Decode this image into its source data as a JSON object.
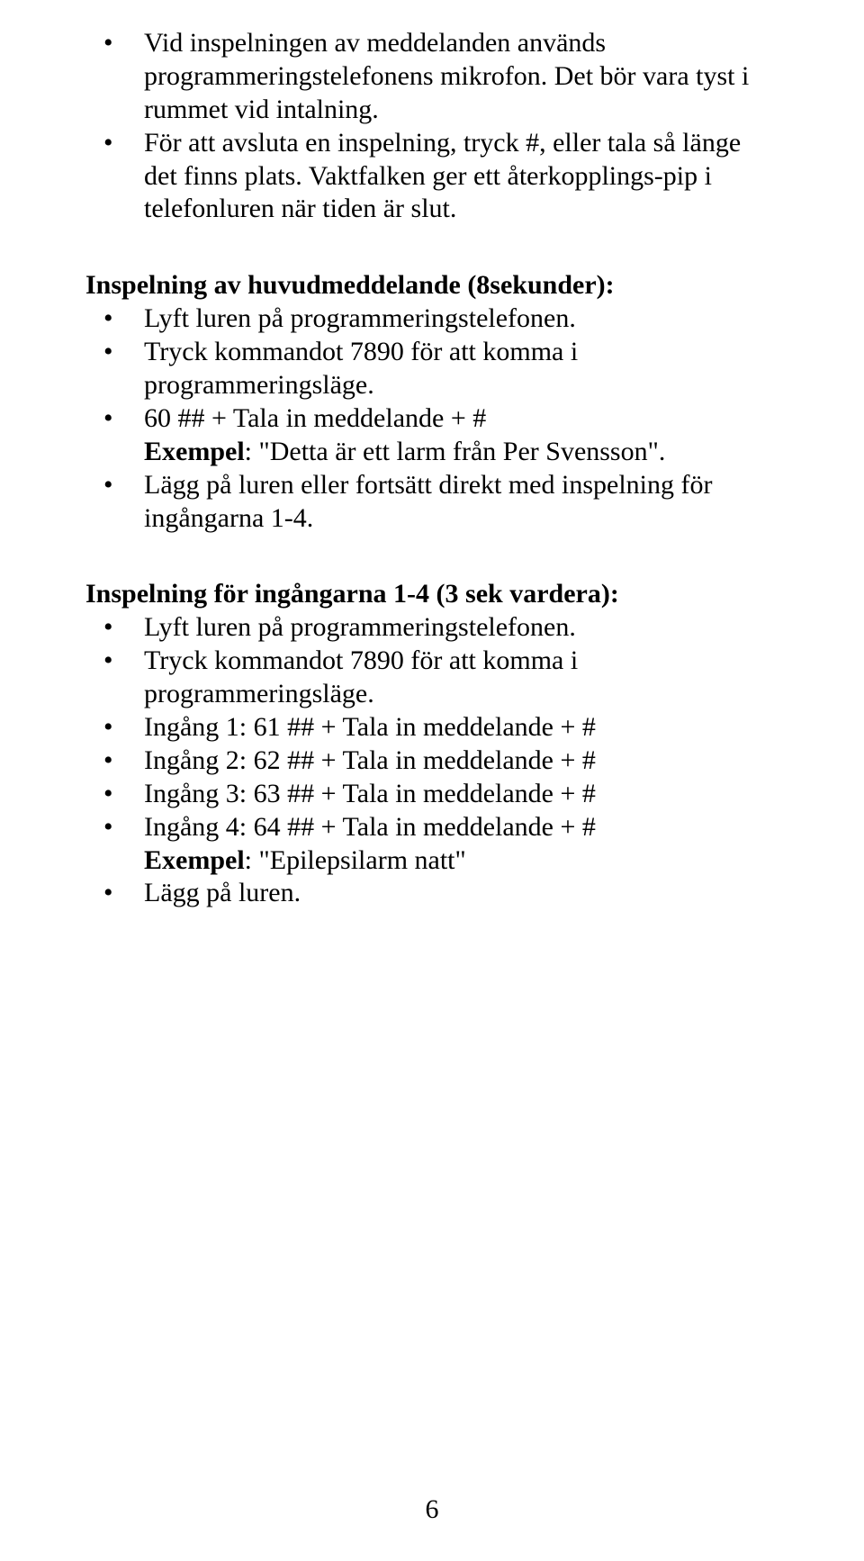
{
  "section1": {
    "items": [
      "Vid inspelningen av meddelanden används programmeringstelefonens mikrofon. Det bör vara tyst i rummet vid intalning.",
      "För att avsluta en inspelning, tryck #, eller tala så länge det finns plats. Vaktfalken ger ett återkopplings-pip  i telefonluren när tiden är slut."
    ]
  },
  "section2": {
    "heading": "Inspelning av huvudmeddelande (8sekunder):",
    "items": [
      "Lyft luren på programmeringstelefonen.",
      "Tryck kommandot 7890 för att komma i programmeringsläge.",
      {
        "pre": "60 ## + Tala in meddelande + #",
        "boldLabel": "Exempel",
        "rest": ": \"Detta är ett larm från Per Svensson\"."
      },
      "Lägg på luren eller fortsätt direkt med inspelning för ingångarna 1-4."
    ]
  },
  "section3": {
    "heading": "Inspelning för ingångarna 1-4 (3 sek vardera):",
    "items": [
      "Lyft luren på programmeringstelefonen.",
      "Tryck kommandot 7890 för att komma i programmeringsläge.",
      "Ingång 1: 61 ## + Tala in meddelande + #",
      "Ingång 2: 62 ## + Tala in meddelande + #",
      "Ingång 3: 63 ## + Tala in meddelande + #",
      {
        "pre": "Ingång 4: 64 ## + Tala in meddelande + #",
        "boldLabel": "Exempel",
        "rest": ": \"Epilepsilarm natt\""
      },
      "Lägg på luren."
    ]
  },
  "pageNumber": "6"
}
